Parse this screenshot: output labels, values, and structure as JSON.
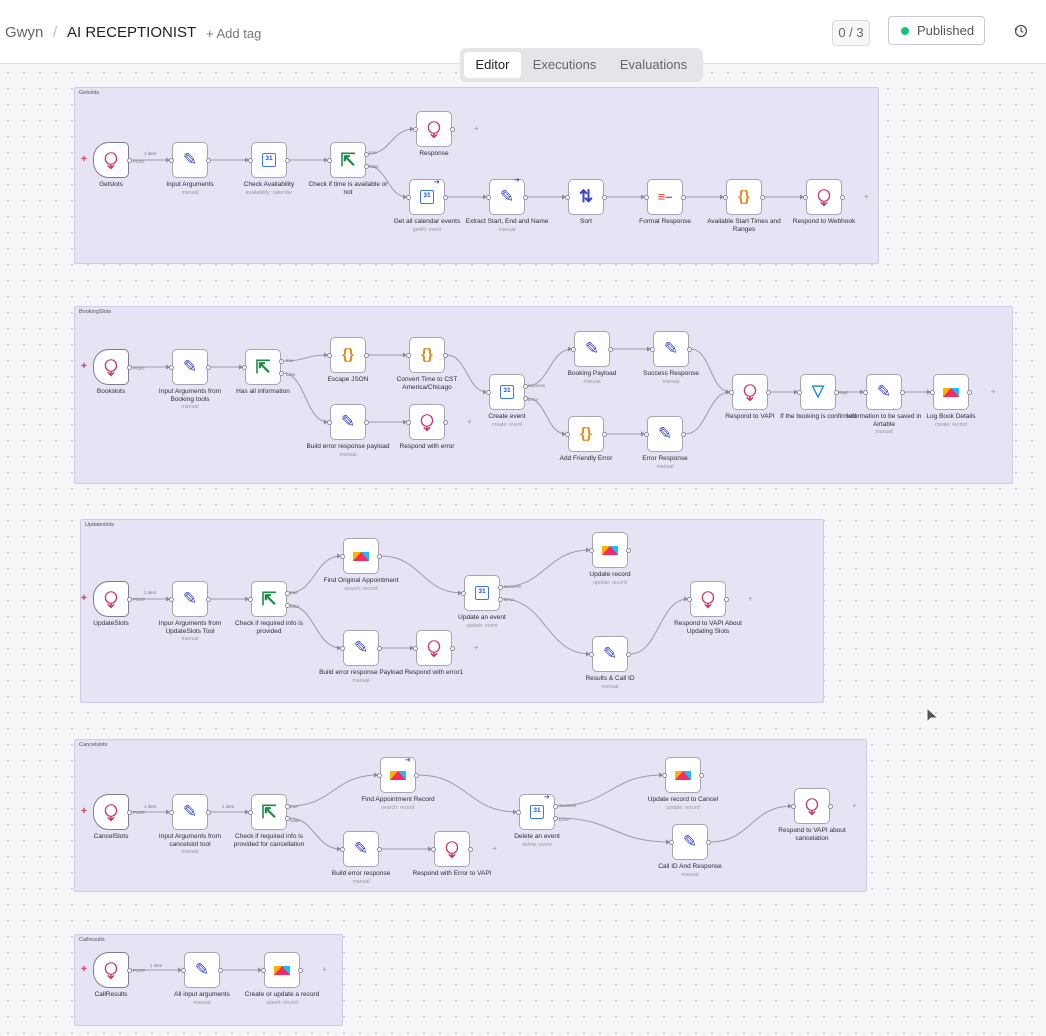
{
  "header": {
    "user": "Gwyn",
    "separator": "/",
    "workflow_name": "AI RECEPTIONIST",
    "add_tag": "+ Add tag",
    "counter": "0 / 3",
    "published_label": "Published",
    "history_icon": "history-icon"
  },
  "tabs": [
    {
      "label": "Editor",
      "active": true
    },
    {
      "label": "Executions",
      "active": false
    },
    {
      "label": "Evaluations",
      "active": false
    }
  ],
  "groups": [
    {
      "id": "g1",
      "title": "Getslots"
    },
    {
      "id": "g2",
      "title": "BookingSlots"
    },
    {
      "id": "g3",
      "title": "Updateslots"
    },
    {
      "id": "g4",
      "title": "Cancelslots"
    },
    {
      "id": "g5",
      "title": "Callresults"
    }
  ],
  "nodes": [
    {
      "id": "getslots",
      "label": "Getslots",
      "sub": "",
      "icon": "webhook-icon",
      "trigger": true
    },
    {
      "id": "g_input",
      "label": "Input Arguments",
      "sub": "manual",
      "icon": "pencil-icon"
    },
    {
      "id": "g_check_avail",
      "label": "Check Availability",
      "sub": "availability: calendar",
      "icon": "google-calendar-icon"
    },
    {
      "id": "g_if",
      "label": "Check if time is available or not",
      "sub": "",
      "icon": "if-icon"
    },
    {
      "id": "g_response",
      "label": "Response",
      "sub": "",
      "icon": "webhook-icon"
    },
    {
      "id": "g_getall",
      "label": "Get all calendar events",
      "sub": "getAll: event",
      "icon": "google-calendar-icon"
    },
    {
      "id": "g_extract",
      "label": "Extract Start, End and Name",
      "sub": "manual",
      "icon": "pencil-icon"
    },
    {
      "id": "g_sort",
      "label": "Sort",
      "sub": "",
      "icon": "sort-icon"
    },
    {
      "id": "g_format",
      "label": "Format Response",
      "sub": "",
      "icon": "format-icon"
    },
    {
      "id": "g_available",
      "label": "Available Start Times and Ranges",
      "sub": "",
      "icon": "code-icon"
    },
    {
      "id": "g_respond",
      "label": "Respond to Webhook",
      "sub": "",
      "icon": "webhook-icon"
    },
    {
      "id": "bookslots",
      "label": "Bookslots",
      "sub": "",
      "icon": "webhook-icon",
      "trigger": true
    },
    {
      "id": "b_input",
      "label": "Input Arguments from Booking tools",
      "sub": "manual",
      "icon": "pencil-icon"
    },
    {
      "id": "b_hasinfo",
      "label": "Has all information",
      "sub": "",
      "icon": "if-icon"
    },
    {
      "id": "b_escape",
      "label": "Escape JSON",
      "sub": "",
      "icon": "code-icon"
    },
    {
      "id": "b_convert",
      "label": "Convert Time to CST America/Chicago",
      "sub": "",
      "icon": "code-icon"
    },
    {
      "id": "b_builderr",
      "label": "Build error response payload",
      "sub": "manual",
      "icon": "pencil-icon"
    },
    {
      "id": "b_resperr",
      "label": "Respond with error",
      "sub": "",
      "icon": "webhook-icon"
    },
    {
      "id": "b_create",
      "label": "Create event",
      "sub": "create: event",
      "icon": "google-calendar-icon"
    },
    {
      "id": "b_payload",
      "label": "Booking Payload",
      "sub": "manual",
      "icon": "pencil-icon"
    },
    {
      "id": "b_success",
      "label": "Success Response",
      "sub": "manual",
      "icon": "pencil-icon"
    },
    {
      "id": "b_friendly",
      "label": "Add Friendly Error",
      "sub": "",
      "icon": "code-icon"
    },
    {
      "id": "b_errresp",
      "label": "Error Response",
      "sub": "manual",
      "icon": "pencil-icon"
    },
    {
      "id": "b_respvapi",
      "label": "Respond to VAPI",
      "sub": "",
      "icon": "webhook-icon"
    },
    {
      "id": "b_ifconf",
      "label": "If the booking is confirmed",
      "sub": "",
      "icon": "filter-icon"
    },
    {
      "id": "b_infoair",
      "label": "Information to be saved in Airtable",
      "sub": "manual",
      "icon": "pencil-icon"
    },
    {
      "id": "b_log",
      "label": "Log Book Details",
      "sub": "create: record",
      "icon": "airtable-icon"
    },
    {
      "id": "updateslots",
      "label": "UpdateSlots",
      "sub": "",
      "icon": "webhook-icon",
      "trigger": true
    },
    {
      "id": "u_input",
      "label": "Inpur Arguments from UpdateSlots Tool",
      "sub": "manual",
      "icon": "pencil-icon"
    },
    {
      "id": "u_check",
      "label": "Check if required info is provided",
      "sub": "",
      "icon": "if-icon"
    },
    {
      "id": "u_find",
      "label": "Find Original Appointment",
      "sub": "search: record",
      "icon": "airtable-icon"
    },
    {
      "id": "u_builderr",
      "label": "Build error response Payload",
      "sub": "manual",
      "icon": "pencil-icon"
    },
    {
      "id": "u_resperr",
      "label": "Respond with error1",
      "sub": "",
      "icon": "webhook-icon"
    },
    {
      "id": "u_update_event",
      "label": "Update an event",
      "sub": "update: event",
      "icon": "google-calendar-icon"
    },
    {
      "id": "u_update_record",
      "label": "Update record",
      "sub": "update: record",
      "icon": "airtable-icon"
    },
    {
      "id": "u_results",
      "label": "Results & Call ID",
      "sub": "manual",
      "icon": "pencil-icon"
    },
    {
      "id": "u_respvapi",
      "label": "Respond to VAPI About Updating Slots",
      "sub": "",
      "icon": "webhook-icon"
    },
    {
      "id": "cancelslots",
      "label": "CancelSlots",
      "sub": "",
      "icon": "webhook-icon",
      "trigger": true
    },
    {
      "id": "c_input",
      "label": "Input Arguments from cancelslot tool",
      "sub": "manual",
      "icon": "pencil-icon"
    },
    {
      "id": "c_check",
      "label": "Check if required info is provided for cancellation",
      "sub": "",
      "icon": "if-icon"
    },
    {
      "id": "c_find",
      "label": "Find Appointment Record",
      "sub": "search: record",
      "icon": "airtable-icon"
    },
    {
      "id": "c_builderr",
      "label": "Build error response",
      "sub": "manual",
      "icon": "pencil-icon"
    },
    {
      "id": "c_resperr",
      "label": "Respond with Error to VAPI",
      "sub": "",
      "icon": "webhook-icon"
    },
    {
      "id": "c_delete",
      "label": "Delete an event",
      "sub": "delete: event",
      "icon": "google-calendar-icon"
    },
    {
      "id": "c_update",
      "label": "Update record to Cancel",
      "sub": "update: record",
      "icon": "airtable-icon"
    },
    {
      "id": "c_callid",
      "label": "Call ID And Response",
      "sub": "manual",
      "icon": "pencil-icon"
    },
    {
      "id": "c_respvapi",
      "label": "Respond to VAPI about cancelation",
      "sub": "",
      "icon": "webhook-icon"
    },
    {
      "id": "callresults",
      "label": "CallResults",
      "sub": "",
      "icon": "webhook-icon",
      "trigger": true
    },
    {
      "id": "r_input",
      "label": "All input arguments",
      "sub": "manual",
      "icon": "pencil-icon"
    },
    {
      "id": "r_upsert",
      "label": "Create or update a record",
      "sub": "upsert: record",
      "icon": "airtable-icon"
    }
  ],
  "edge_labels": {
    "post": "POST",
    "one_item": "1 item",
    "true": "true",
    "false": "false",
    "success": "Success",
    "error": "Error",
    "kept": "Kept"
  },
  "icons": {
    "webhook-icon": "⧬",
    "pencil-icon": "✎",
    "if-icon": "⇱",
    "code-icon": "{}",
    "sort-icon": "⇅",
    "format-icon": "≡–",
    "filter-icon": "▽",
    "google-calendar-icon": "31",
    "airtable-icon": ""
  },
  "colors": {
    "accent": "#3d49c4",
    "published": "#19c27a",
    "group_bg": "#e6e3f5",
    "webhook": "#c8336a",
    "code": "#e78a1e"
  }
}
